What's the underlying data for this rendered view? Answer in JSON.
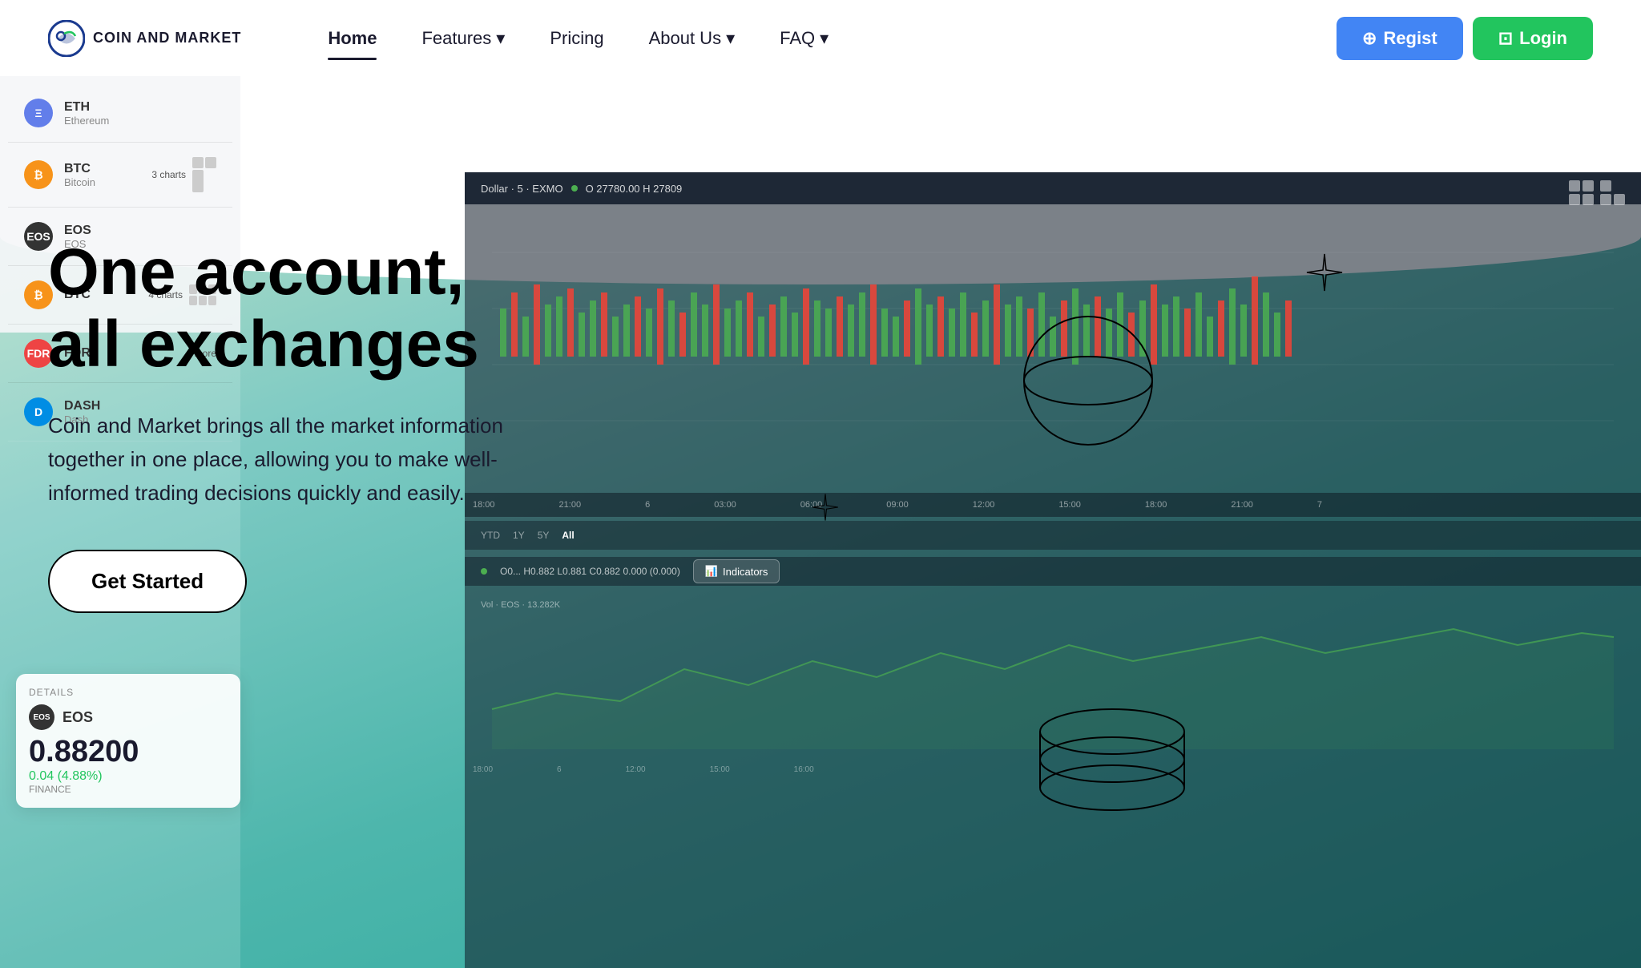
{
  "nav": {
    "logo_text": "COIN AND MARKET",
    "items": [
      {
        "label": "Home",
        "active": true,
        "has_dropdown": false
      },
      {
        "label": "Features",
        "active": false,
        "has_dropdown": true
      },
      {
        "label": "Pricing",
        "active": false,
        "has_dropdown": false
      },
      {
        "label": "About Us",
        "active": false,
        "has_dropdown": true
      },
      {
        "label": "FAQ",
        "active": false,
        "has_dropdown": true
      }
    ],
    "register_label": "Regist",
    "login_label": "Login"
  },
  "hero": {
    "title_line1": "One account,",
    "title_line2": "all exchanges",
    "subtitle": "Coin and Market brings all the market information together in one place, allowing you to make well-informed trading decisions quickly and easily.",
    "cta_label": "Get Started"
  },
  "sidebar_coins": [
    {
      "symbol": "ETH",
      "name": "Ethereum",
      "color": "#627eea"
    },
    {
      "symbol": "BTC",
      "name": "Bitcoin",
      "color": "#f7931a"
    },
    {
      "symbol": "EOS",
      "name": "EOS",
      "color": "#333"
    },
    {
      "symbol": "BTC",
      "name": "Bitcoin",
      "color": "#f7931a"
    },
    {
      "symbol": "FDR",
      "name": "FDR",
      "color": "#e44"
    },
    {
      "symbol": "DASH",
      "name": "Dash",
      "color": "#008de4"
    }
  ],
  "chart": {
    "header_text": "Dollar · 5 · EXMO",
    "ohlc": "O 27780.00  H 27809",
    "time_labels": [
      "YTD",
      "1Y",
      "5Y",
      "All"
    ],
    "active_time": "All",
    "price_times": [
      "18:00",
      "21:00",
      "6",
      "03:00",
      "06:00",
      "09:00",
      "12:00",
      "15:00",
      "18:00",
      "21:00",
      "7"
    ]
  },
  "details_box": {
    "label": "DETAILS",
    "coin": "EOS",
    "finance_label": "FINANCE",
    "price": "0.88200",
    "change": "0.04 (4.88%)"
  },
  "eos_chart": {
    "header": "O0...  H0.882  L0.881  C0.882  0.000 (0.000)",
    "volume": "Vol · EOS · 13.282K"
  }
}
